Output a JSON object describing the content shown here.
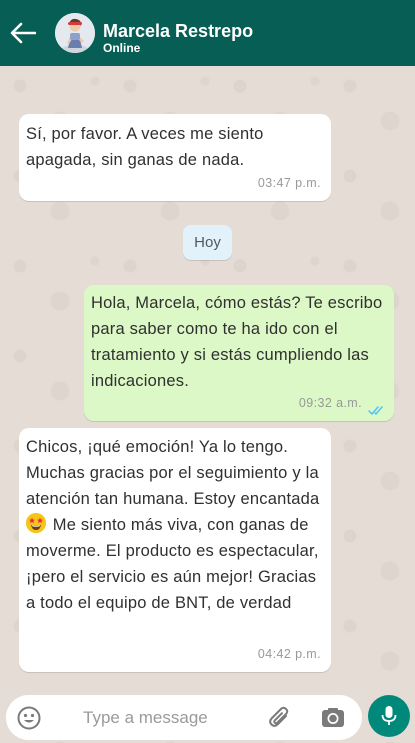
{
  "header": {
    "contact_name": "Marcela Restrepo",
    "status": "Online",
    "back_icon": "arrow-left-icon",
    "bg_color": "#075e54"
  },
  "messages": [
    {
      "direction": "in",
      "text": "Sí, por favor. A veces me siento apagada, sin ganas de nada.",
      "time": "03:47 p.m."
    },
    {
      "direction": "out",
      "text": "Hola, Marcela, cómo estás? Te escribo para saber como te ha ido con el tratamiento y si estás cumpliendo las indicaciones.",
      "time": "09:32 a.m.",
      "read": true
    },
    {
      "direction": "in",
      "text_before_emoji": "Chicos, ¡qué emoción! Ya lo tengo. Muchas gracias por el seguimiento y la atención tan humana. Estoy encantada ",
      "emoji": "star-struck-emoji",
      "text_after_emoji": " Me siento más viva, con ganas de moverme. El producto es espectacular, ¡pero el servicio es aún mejor! Gracias a todo el equipo de BNT, de verdad",
      "time": "04:42 p.m."
    }
  ],
  "date_separator": "Hoy",
  "composer": {
    "placeholder": "Type a message",
    "emoji_icon": "smiley-icon",
    "attach_icon": "paperclip-icon",
    "camera_icon": "camera-icon",
    "mic_icon": "microphone-icon"
  },
  "colors": {
    "outgoing_bubble": "#dcf8c6",
    "incoming_bubble": "#ffffff",
    "date_pill": "#e1f2fb",
    "mic_button": "#00897b",
    "read_ticks": "#4fc3f7"
  }
}
